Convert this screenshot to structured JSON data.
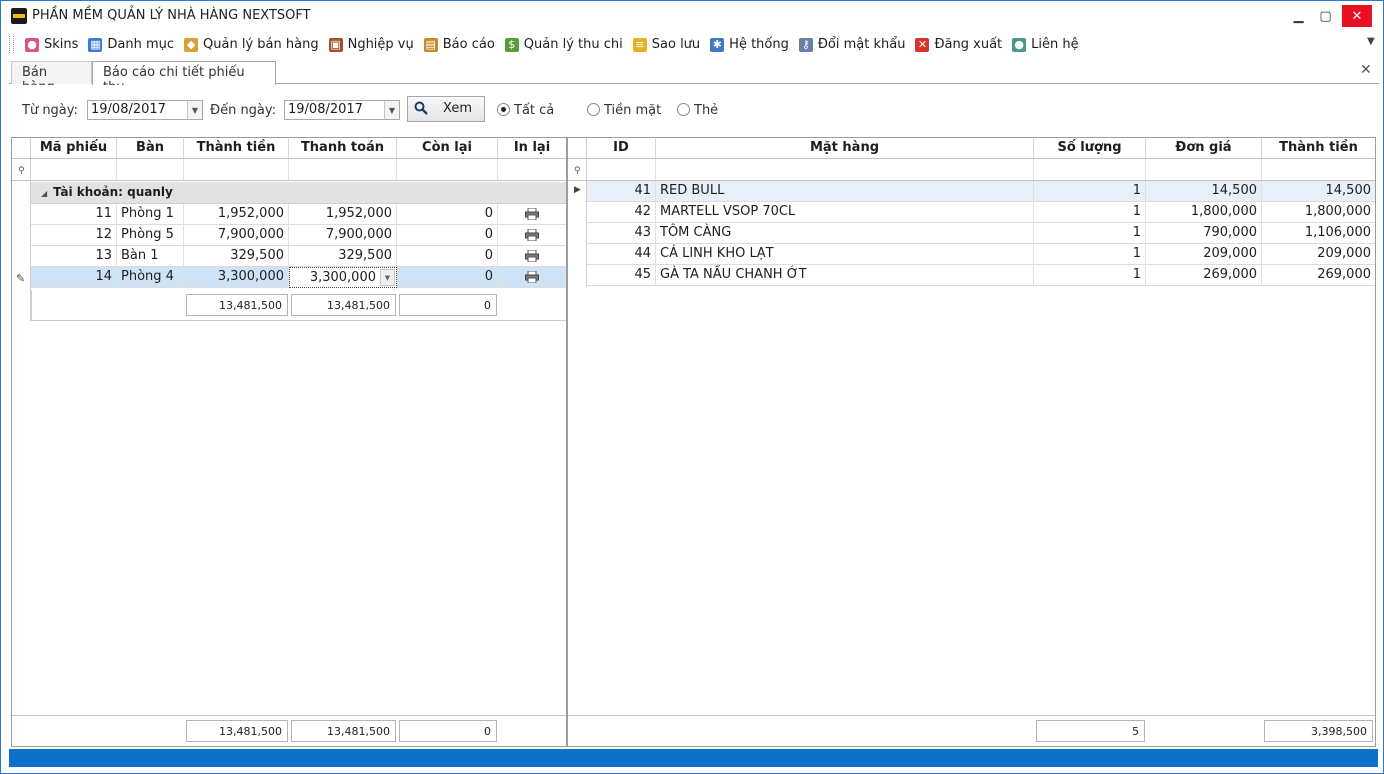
{
  "window": {
    "title": "PHẦN MỀM QUẢN LÝ NHÀ HÀNG NEXTSOFT",
    "minimize": "▁",
    "maximize": "▢",
    "close": "✕"
  },
  "menu": {
    "items": [
      {
        "label": "Skins",
        "icon": "skins-palette-icon",
        "color": "#e0508a"
      },
      {
        "label": "Danh mục",
        "icon": "grid-icon",
        "color": "#3a7bd5"
      },
      {
        "label": "Quản lý bán hàng",
        "icon": "tag-icon",
        "color": "#d7a13a"
      },
      {
        "label": "Nghiệp vụ",
        "icon": "briefcase-icon",
        "color": "#a0522d"
      },
      {
        "label": "Báo cáo",
        "icon": "clipboard-icon",
        "color": "#c58c2a"
      },
      {
        "label": "Quản lý thu chi",
        "icon": "coins-icon",
        "color": "#5a9e3a"
      },
      {
        "label": "Sao lưu",
        "icon": "database-icon",
        "color": "#e6b422"
      },
      {
        "label": "Hệ thống",
        "icon": "gears-icon",
        "color": "#3f79c2"
      },
      {
        "label": "Đổi mật khẩu",
        "icon": "key-icon",
        "color": "#6b7fa8"
      },
      {
        "label": "Đăng xuất",
        "icon": "logout-icon",
        "color": "#d8342b"
      },
      {
        "label": "Liên hệ",
        "icon": "user-icon",
        "color": "#4a9a8c"
      }
    ]
  },
  "tabs": [
    {
      "label": "Bán hàng"
    },
    {
      "label": "Báo cáo chi tiết phiếu thu"
    }
  ],
  "filter": {
    "from_label": "Từ ngày:",
    "from_value": "19/08/2017",
    "to_label": "Đến ngày:",
    "to_value": "19/08/2017",
    "view_button": "Xem",
    "radios": [
      {
        "label": "Tất cả",
        "checked": true
      },
      {
        "label": "Tiền mặt",
        "checked": false
      },
      {
        "label": "Thẻ",
        "checked": false
      }
    ]
  },
  "left_grid": {
    "columns": [
      "Mã phiếu",
      "Bàn",
      "Thành tiền",
      "Thanh toán",
      "Còn lại",
      "In lại"
    ],
    "group_label": "Tài khoản: quanly",
    "rows": [
      {
        "id": "11",
        "table": "Phòng 1",
        "total": "1,952,000",
        "paid": "1,952,000",
        "remain": "0"
      },
      {
        "id": "12",
        "table": "Phòng 5",
        "total": "7,900,000",
        "paid": "7,900,000",
        "remain": "0"
      },
      {
        "id": "13",
        "table": "Bàn 1",
        "total": "329,500",
        "paid": "329,500",
        "remain": "0"
      },
      {
        "id": "14",
        "table": "Phòng 4",
        "total": "3,300,000",
        "paid": "3,300,000",
        "remain": "0"
      }
    ],
    "group_sums": {
      "total": "13,481,500",
      "paid": "13,481,500",
      "remain": "0"
    },
    "footer_sums": {
      "total": "13,481,500",
      "paid": "13,481,500",
      "remain": "0"
    }
  },
  "right_grid": {
    "columns": [
      "ID",
      "Mặt hàng",
      "Số lượng",
      "Đơn giá",
      "Thành tiền"
    ],
    "rows": [
      {
        "id": "41",
        "item": "RED BULL",
        "qty": "1",
        "price": "14,500",
        "total": "14,500"
      },
      {
        "id": "42",
        "item": "MARTELL VSOP 70CL",
        "qty": "1",
        "price": "1,800,000",
        "total": "1,800,000"
      },
      {
        "id": "43",
        "item": "TÔM CÀNG",
        "qty": "1",
        "price": "790,000",
        "total": "1,106,000"
      },
      {
        "id": "44",
        "item": "CÁ LINH KHO LẠT",
        "qty": "1",
        "price": "209,000",
        "total": "209,000"
      },
      {
        "id": "45",
        "item": "GÀ TA NẤU CHANH ỚT",
        "qty": "1",
        "price": "269,000",
        "total": "269,000"
      }
    ],
    "footer_sums": {
      "qty": "5",
      "total": "3,398,500"
    }
  }
}
